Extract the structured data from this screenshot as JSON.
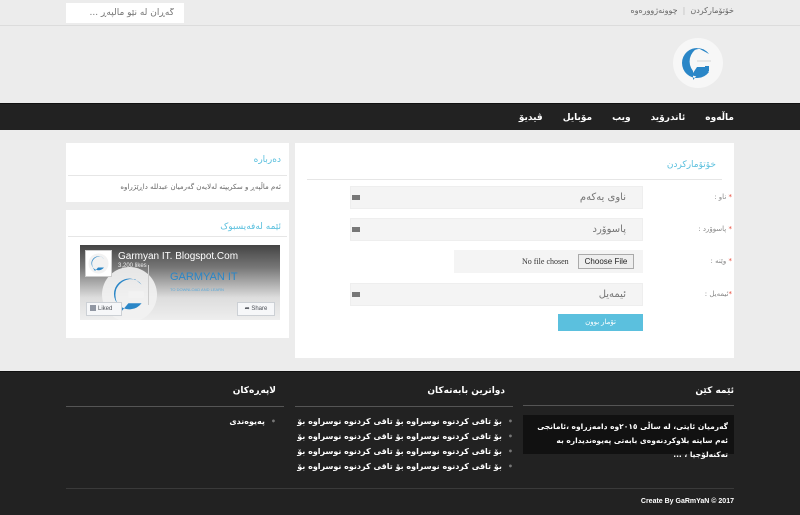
{
  "topbar": {
    "search_placeholder": "گەڕان لە نێو ماڵپەڕ ...",
    "links": [
      "خۆتۆمارکردن",
      "چوونەژوورەوە"
    ],
    "separator": "|"
  },
  "header": {
    "logo": "garmyan-it-logo"
  },
  "nav": {
    "items": [
      "ماڵەوە",
      "ئاندرۆید",
      "ویب",
      "مۆبایل",
      "ڤیدیۆ"
    ]
  },
  "sidebar": {
    "about": {
      "title": "دەربارە",
      "text": "ئەم ماڵپەڕ و سکریپتە لەلایەن گەرمیان عبدللە داڕێژراوە"
    },
    "facebook": {
      "title": "ئێمە لەفەیسبوک",
      "page_name": "Garmyan IT. Blogspot.Com",
      "likes": "3,200 likes",
      "brand": "GARMYAN IT",
      "tagline": "TO DOWNLOAD AND LEARN",
      "liked_label": "Liked",
      "share_label": "Share"
    }
  },
  "form": {
    "title": "خۆتۆمارکردن",
    "required_mark": "*",
    "fields": [
      {
        "label": "ناو :",
        "placeholder": "ناوی یەکەم"
      },
      {
        "label": "پاسوۆرد :",
        "placeholder": "پاسوۆرد"
      },
      {
        "label": "وێنە :",
        "file_status": "No file chosen",
        "file_button": "Choose File"
      },
      {
        "label": "ئیمەیل :",
        "placeholder": "ئیمەیل"
      }
    ],
    "submit_label": "تۆمار بوون"
  },
  "footer": {
    "about": {
      "title": "ئێمە کێن",
      "text": "گەرمیان ئایتی، لە ساڵی ٢٠١٥وە دامەزراوە ،ئامانجی ئەم سایتە بلاوکردنەوەی بابەتی پەیوەندیدارە بە تەکنەلۆجیا ، ..."
    },
    "recent": {
      "title": "دواترین بابەتەکان",
      "items": [
        "بۆ تاقی کردنوە نوسراوە بۆ تاقی کردنوە نوسراوە بۆ تـ..",
        "بۆ تاقی کردنوە نوسراوە بۆ تاقی کردنوە نوسراوە بۆ تـ..",
        "بۆ تاقی کردنوە نوسراوە بۆ تاقی کردنوە نوسراوە بۆ تـ..",
        "بۆ تاقی کردنوە نوسراوە بۆ تاقی کردنوە نوسراوە بۆ تـ.."
      ]
    },
    "pages": {
      "title": "لاپەڕەکان",
      "items": [
        "پەیوەندی"
      ]
    },
    "copyright": "Create By GaRmYaN © 2017"
  },
  "colors": {
    "accent": "#5bc0de",
    "dark": "#222222",
    "required": "#e74c3c",
    "logo_blue": "#2a86c7"
  }
}
